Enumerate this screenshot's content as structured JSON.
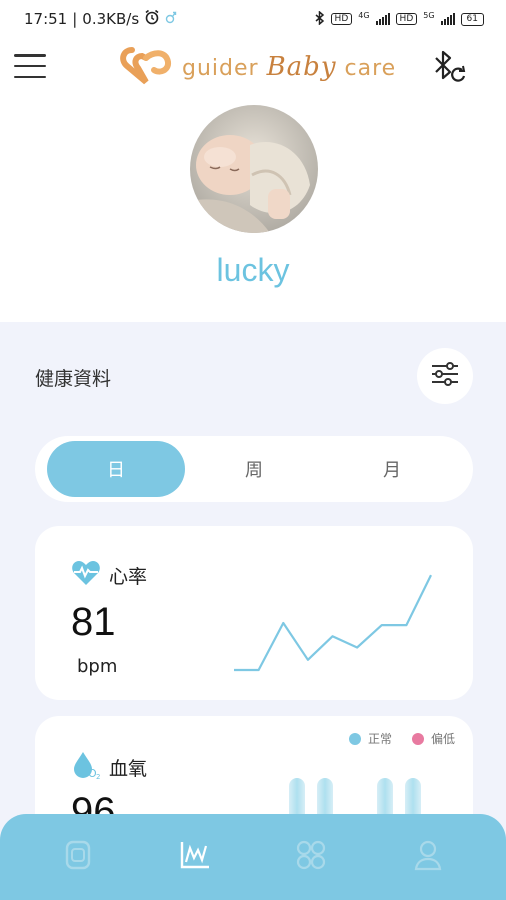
{
  "status_bar": {
    "time": "17:51",
    "speed": "0.3KB/s",
    "battery": "61",
    "network_a": "4G",
    "network_b": "5G",
    "hd": "HD"
  },
  "header": {
    "logo_guider": "guider",
    "logo_baby": "Baby",
    "logo_care": "care"
  },
  "profile": {
    "name": "lucky"
  },
  "health": {
    "title": "健康資料",
    "tabs": [
      {
        "label": "日",
        "active": true
      },
      {
        "label": "周",
        "active": false
      },
      {
        "label": "月",
        "active": false
      }
    ]
  },
  "heart_rate": {
    "title": "心率",
    "value": "81",
    "unit": "bpm",
    "trend": [
      2,
      2,
      48,
      12,
      35,
      24,
      46,
      46,
      95
    ]
  },
  "oxygen": {
    "title": "血氧",
    "value": "96",
    "legend": [
      {
        "label": "正常",
        "color": "#7ec8e3"
      },
      {
        "label": "偏低",
        "color": "#e87aa0"
      }
    ]
  },
  "colors": {
    "accent": "#7ec8e3",
    "name": "#6cc3e0",
    "background": "#f1f3fb"
  },
  "bottom_nav": {
    "items": [
      "watch-icon",
      "chart-icon",
      "apps-icon",
      "profile-icon"
    ]
  }
}
